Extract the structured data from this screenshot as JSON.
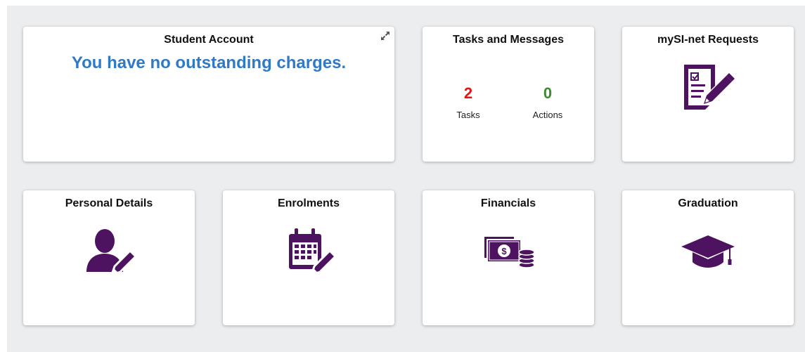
{
  "colors": {
    "accent_purple": "#4d1360",
    "charge_blue": "#2f79c7",
    "tasks_red": "#ee1111",
    "actions_green": "#3c8b32"
  },
  "student_account": {
    "title": "Student Account",
    "message": "You have no outstanding charges.",
    "expand_icon": "expand-icon"
  },
  "tasks_messages": {
    "title": "Tasks and Messages",
    "tasks_count": "2",
    "tasks_label": "Tasks",
    "actions_count": "0",
    "actions_label": "Actions"
  },
  "requests": {
    "title": "mySI-net Requests",
    "icon": "document-edit-icon"
  },
  "personal_details": {
    "title": "Personal Details",
    "icon": "user-edit-icon"
  },
  "enrolments": {
    "title": "Enrolments",
    "icon": "calendar-edit-icon"
  },
  "financials": {
    "title": "Financials",
    "icon": "money-coins-icon"
  },
  "graduation": {
    "title": "Graduation",
    "icon": "graduation-cap-icon"
  }
}
